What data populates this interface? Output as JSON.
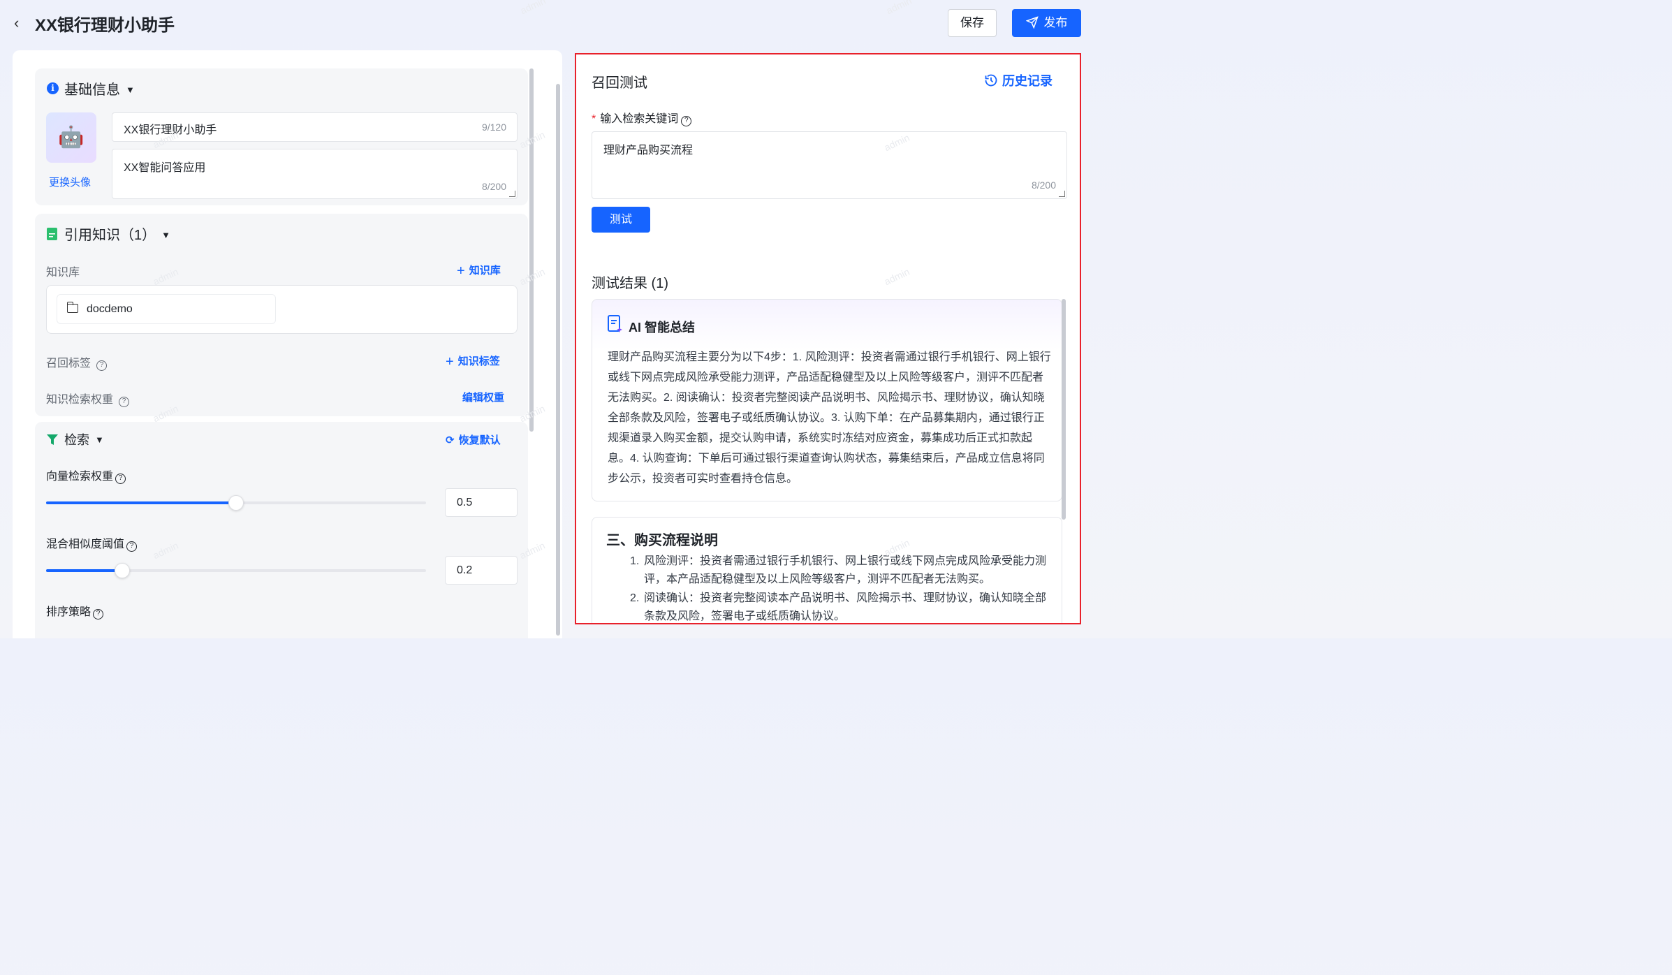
{
  "header": {
    "title": "XX银行理财小助手",
    "save_label": "保存",
    "publish_label": "发布"
  },
  "basic_info": {
    "title": "基础信息",
    "change_avatar": "更换头像",
    "name_value": "XX银行理财小助手",
    "name_counter": "9/120",
    "desc_value": "XX智能问答应用",
    "desc_counter": "8/200"
  },
  "knowledge": {
    "title": "引用知识（1）",
    "kb_label": "知识库",
    "add_kb": "知识库",
    "kb_item": "docdemo",
    "recall_tag_label": "召回标签",
    "add_tag": "知识标签",
    "weight_label": "知识检索权重",
    "edit_weight": "编辑权重"
  },
  "search": {
    "title": "检索",
    "reset": "恢复默认",
    "vector_weight_label": "向量检索权重",
    "vector_weight_value": "0.5",
    "vector_weight_fraction": 0.5,
    "similarity_label": "混合相似度阈值",
    "similarity_value": "0.2",
    "similarity_fraction": 0.2,
    "sort_label": "排序策略"
  },
  "recall_test": {
    "title": "召回测试",
    "history": "历史记录",
    "keyword_label": "输入检索关键词",
    "keyword_value": "理财产品购买流程",
    "keyword_counter": "8/200",
    "test_button": "测试",
    "result_title": "测试结果 (1)",
    "ai_title": "AI 智能总结",
    "ai_text": "理财产品购买流程主要分为以下4步：1. 风险测评：投资者需通过银行手机银行、网上银行或线下网点完成风险承受能力测评，产品适配稳健型及以上风险等级客户，测评不匹配者无法购买。2. 阅读确认：投资者完整阅读产品说明书、风险揭示书、理财协议，确认知晓全部条款及风险，签署电子或纸质确认协议。3. 认购下单：在产品募集期内，通过银行正规渠道录入购买金额，提交认购申请，系统实时冻结对应资金，募集成功后正式扣款起息。4. 认购查询：下单后可通过银行渠道查询认购状态，募集结束后，产品成立信息将同步公示，投资者可实时查看持仓信息。",
    "doc_title": "三、购买流程说明",
    "doc_items": [
      {
        "n": "1.",
        "text": "风险测评：投资者需通过银行手机银行、网上银行或线下网点完成风险承受能力测评，本产品适配稳健型及以上风险等级客户，测评不匹配者无法购买。"
      },
      {
        "n": "2.",
        "text": "阅读确认：投资者完整阅读本产品说明书、风险揭示书、理财协议，确认知晓全部条款及风险，签署电子或纸质确认协议。"
      }
    ]
  },
  "watermark_text": "admin",
  "colors": {
    "accent": "#1664ff",
    "highlight_border": "#e8212b"
  }
}
